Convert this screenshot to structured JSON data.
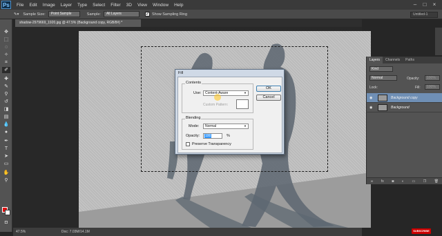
{
  "app": {
    "logo": "Ps"
  },
  "menu": [
    "File",
    "Edit",
    "Image",
    "Layer",
    "Type",
    "Select",
    "Filter",
    "3D",
    "View",
    "Window",
    "Help"
  ],
  "options_bar": {
    "sample_size_label": "Sample Size:",
    "sample_size_value": "Point Sample",
    "sample_label": "Sample:",
    "sample_value": "All Layers",
    "show_ring_label": "Show Sampling Ring",
    "workspace": "Untitled-1"
  },
  "document": {
    "tab_title": "shadow-2979669_1920.jpg @ 47.5% (Background copy, RGB/8#) *",
    "zoom": "47.5%",
    "doc_info": "Doc: 7.03M/14.1M"
  },
  "fill_dialog": {
    "title": "Fill",
    "contents_label": "Contents",
    "use_label": "Use:",
    "use_value": "Content-Aware",
    "custom_pattern_label": "Custom Pattern:",
    "blending_label": "Blending",
    "mode_label": "Mode:",
    "mode_value": "Normal",
    "opacity_label": "Opacity:",
    "opacity_value": "100",
    "percent": "%",
    "preserve_label": "Preserve Transparency",
    "ok_label": "OK",
    "cancel_label": "Cancel"
  },
  "layers_panel": {
    "tabs": [
      "Layers",
      "Channels",
      "Paths"
    ],
    "kind_label": "Kind",
    "blend_mode": "Normal",
    "opacity_label": "Opacity:",
    "opacity_value": "100%",
    "lock_label": "Lock:",
    "fill_label": "Fill:",
    "fill_value": "100%",
    "layers": [
      {
        "name": "Background copy",
        "selected": true
      },
      {
        "name": "Background",
        "selected": false
      }
    ]
  },
  "colors": {
    "foreground": "#e01010",
    "background": "#ffffff",
    "selected_layer": "#6f8fb5"
  },
  "subscribe_badge": "SUBSCRIBE"
}
